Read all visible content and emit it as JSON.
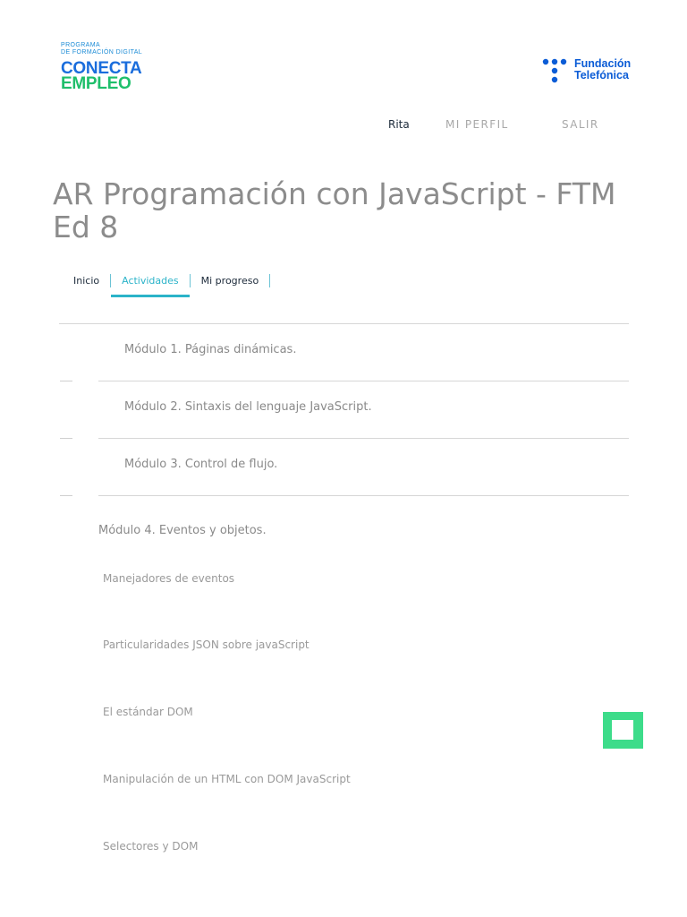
{
  "brand": {
    "program_line1": "PROGRAMA",
    "program_line2": "DE FORMACIÓN DIGITAL",
    "name_line1": "CONECTA",
    "name_line2": "EMPLEO",
    "partner_line1": "Fundación",
    "partner_line2": "Telefónica"
  },
  "topnav": {
    "user_name": "Rita",
    "profile_label": "MI PERFIL",
    "logout_label": "SALIR"
  },
  "course_title": "AR Programación con JavaScript - FTM Ed 8",
  "tabs": [
    {
      "label": "Inicio",
      "active": false
    },
    {
      "label": "Actividades",
      "active": true
    },
    {
      "label": "Mi progreso",
      "active": false
    }
  ],
  "modules": [
    {
      "title": "Módulo 1. Páginas dinámicas."
    },
    {
      "title": "Módulo 2. Sintaxis del lenguaje JavaScript."
    },
    {
      "title": "Módulo 3. Control de flujo."
    },
    {
      "title": "Módulo 4. Eventos y objetos.",
      "items": [
        "Manejadores de eventos",
        "Particularidades JSON sobre javaScript",
        "El estándar DOM",
        "Manipulación de un HTML con DOM JavaScript",
        "Selectores y DOM"
      ]
    }
  ],
  "colors": {
    "accent": "#2bb3c9",
    "brand_blue": "#1a6ddc",
    "brand_green": "#1fbf6b",
    "floating_button": "#3ddc8a"
  }
}
